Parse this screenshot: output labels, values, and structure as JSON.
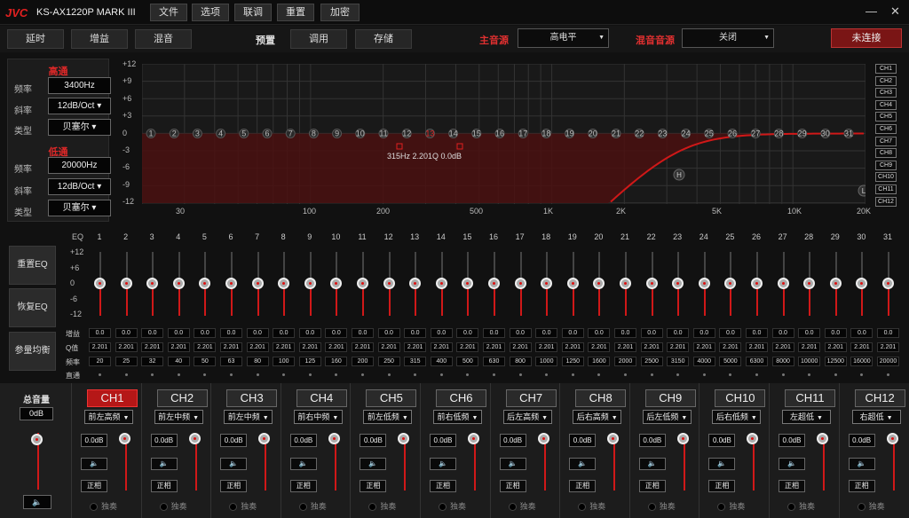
{
  "app": {
    "logo": "JVC",
    "model": "KS-AX1220P MARK III"
  },
  "menu": [
    {
      "label": "文件"
    },
    {
      "label": "选项"
    },
    {
      "label": "联调"
    },
    {
      "label": "重置"
    },
    {
      "label": "加密"
    }
  ],
  "window_controls": {
    "minimize": "—",
    "close": "✕"
  },
  "toolbar": {
    "delay": "延时",
    "gain": "增益",
    "mix": "混音",
    "preset_label": "预置",
    "recall": "调用",
    "store": "存储",
    "main_source_label": "主音源",
    "main_source_value": "高电平",
    "mix_source_label": "混音音源",
    "mix_source_value": "关闭",
    "connection": "未连接"
  },
  "crossover": {
    "hp_title": "高通",
    "lp_title": "低通",
    "freq_label": "频率",
    "slope_label": "斜率",
    "type_label": "类型",
    "hp": {
      "freq": "3400Hz",
      "slope": "12dB/Oct",
      "type": "贝塞尔"
    },
    "lp": {
      "freq": "20000Hz",
      "slope": "12dB/Oct",
      "type": "贝塞尔"
    }
  },
  "graph": {
    "y_ticks": [
      "+12",
      "+9",
      "+6",
      "+3",
      "0",
      "-3",
      "-6",
      "-9",
      "-12"
    ],
    "x_ticks": [
      "30",
      "100",
      "200",
      "500",
      "1K",
      "2K",
      "5K",
      "10K",
      "20K"
    ],
    "band_points": [
      "1",
      "2",
      "3",
      "4",
      "5",
      "6",
      "7",
      "8",
      "9",
      "10",
      "11",
      "12",
      "13",
      "14",
      "15",
      "16",
      "17",
      "18",
      "19",
      "20",
      "21",
      "22",
      "23",
      "24",
      "25",
      "26",
      "27",
      "28",
      "29",
      "30",
      "31"
    ],
    "selected_band": "13",
    "annotation": {
      "freq": "315Hz",
      "q": "2.201Q",
      "gain": "0.0dB"
    },
    "markers": {
      "hp": "H",
      "lp": "L"
    },
    "accent": "#d01818"
  },
  "channels_list": [
    "CH1",
    "CH2",
    "CH3",
    "CH4",
    "CH5",
    "CH6",
    "CH7",
    "CH8",
    "CH9",
    "CH10",
    "CH11",
    "CH12"
  ],
  "eq": {
    "header": "EQ",
    "db_labels": [
      "+12",
      "+6",
      "0",
      "-6",
      "-12"
    ],
    "reset_btn": "重置EQ",
    "restore_btn": "恢复EQ",
    "param_btn": "参量均衡",
    "row_labels": {
      "gain": "增益",
      "q": "Q值",
      "freq": "频率",
      "bypass": "直通"
    },
    "bands": [
      "1",
      "2",
      "3",
      "4",
      "5",
      "6",
      "7",
      "8",
      "9",
      "10",
      "11",
      "12",
      "13",
      "14",
      "15",
      "16",
      "17",
      "18",
      "19",
      "20",
      "21",
      "22",
      "23",
      "24",
      "25",
      "26",
      "27",
      "28",
      "29",
      "30",
      "31"
    ],
    "gains": [
      "0.0",
      "0.0",
      "0.0",
      "0.0",
      "0.0",
      "0.0",
      "0.0",
      "0.0",
      "0.0",
      "0.0",
      "0.0",
      "0.0",
      "0.0",
      "0.0",
      "0.0",
      "0.0",
      "0.0",
      "0.0",
      "0.0",
      "0.0",
      "0.0",
      "0.0",
      "0.0",
      "0.0",
      "0.0",
      "0.0",
      "0.0",
      "0.0",
      "0.0",
      "0.0",
      "0.0"
    ],
    "qs": [
      "2.201",
      "2.201",
      "2.201",
      "2.201",
      "2.201",
      "2.201",
      "2.201",
      "2.201",
      "2.201",
      "2.201",
      "2.201",
      "2.201",
      "2.201",
      "2.201",
      "2.201",
      "2.201",
      "2.201",
      "2.201",
      "2.201",
      "2.201",
      "2.201",
      "2.201",
      "2.201",
      "2.201",
      "2.201",
      "2.201",
      "2.201",
      "2.201",
      "2.201",
      "2.201",
      "2.201"
    ],
    "freqs": [
      "20",
      "25",
      "32",
      "40",
      "50",
      "63",
      "80",
      "100",
      "125",
      "160",
      "200",
      "250",
      "315",
      "400",
      "500",
      "630",
      "800",
      "1000",
      "1250",
      "1600",
      "2000",
      "2500",
      "3150",
      "4000",
      "5000",
      "6300",
      "8000",
      "10000",
      "12500",
      "16000",
      "20000"
    ]
  },
  "master": {
    "label": "总音量",
    "value": "0dB",
    "mute_icon": "🔈"
  },
  "strips": [
    {
      "name": "CH1",
      "pos": "前左高频",
      "active": true
    },
    {
      "name": "CH2",
      "pos": "前左中频",
      "active": false
    },
    {
      "name": "CH3",
      "pos": "前左中频",
      "active": false
    },
    {
      "name": "CH4",
      "pos": "前右中频",
      "active": false
    },
    {
      "name": "CH5",
      "pos": "前左低频",
      "active": false
    },
    {
      "name": "CH6",
      "pos": "前右低频",
      "active": false
    },
    {
      "name": "CH7",
      "pos": "后左高频",
      "active": false
    },
    {
      "name": "CH8",
      "pos": "后右高频",
      "active": false
    },
    {
      "name": "CH9",
      "pos": "后左低频",
      "active": false
    },
    {
      "name": "CH10",
      "pos": "后右低频",
      "active": false
    },
    {
      "name": "CH11",
      "pos": "左超低",
      "active": false
    },
    {
      "name": "CH12",
      "pos": "右超低",
      "active": false
    }
  ],
  "strip_common": {
    "value": "0.0dB",
    "mute_icon": "🔈",
    "phase": "正相",
    "solo": "独奏"
  }
}
